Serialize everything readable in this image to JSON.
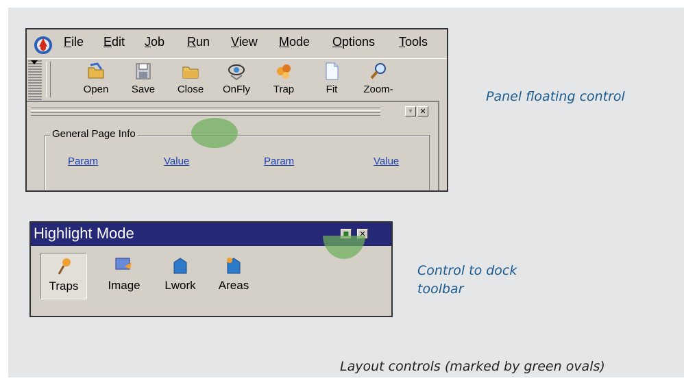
{
  "menu": {
    "items": [
      {
        "label": "File"
      },
      {
        "label": "Edit"
      },
      {
        "label": "Job"
      },
      {
        "label": "Run"
      },
      {
        "label": "View"
      },
      {
        "label": "Mode"
      },
      {
        "label": "Options"
      },
      {
        "label": "Tools"
      }
    ]
  },
  "toolbar": {
    "buttons": [
      {
        "label": "Open",
        "icon": "open-folder-icon"
      },
      {
        "label": "Save",
        "icon": "floppy-disk-icon"
      },
      {
        "label": "Close",
        "icon": "close-folder-icon"
      },
      {
        "label": "OnFly",
        "icon": "onfly-icon"
      },
      {
        "label": "Trap",
        "icon": "trap-icon"
      },
      {
        "label": "Fit",
        "icon": "page-icon"
      },
      {
        "label": "Zoom-",
        "icon": "zoom-icon"
      }
    ]
  },
  "panel": {
    "group_title": "General Page Info",
    "columns": [
      "Param",
      "Value",
      "Param",
      "Value"
    ],
    "buttons": {
      "minimize": "▾",
      "close": "✕"
    }
  },
  "highlight_toolbar": {
    "title": "Highlight Mode",
    "dock_symbol": "▪",
    "close_symbol": "✕",
    "tools": [
      {
        "label": "Traps",
        "icon": "traps-icon",
        "pressed": true
      },
      {
        "label": "Image",
        "icon": "image-icon",
        "pressed": false
      },
      {
        "label": "Lwork",
        "icon": "lwork-icon",
        "pressed": false
      },
      {
        "label": "Areas",
        "icon": "areas-icon",
        "pressed": false
      }
    ]
  },
  "captions": {
    "panel_floating": "Panel floating control",
    "dock_line1": "Control to dock",
    "dock_line2": "toolbar",
    "footer": "Layout controls (marked by green ovals)"
  },
  "colors": {
    "background": "#e4e6e8",
    "caption_blue": "#1a5a8e",
    "titlebar": "#242877",
    "oval_green": "#6eaf5a"
  }
}
